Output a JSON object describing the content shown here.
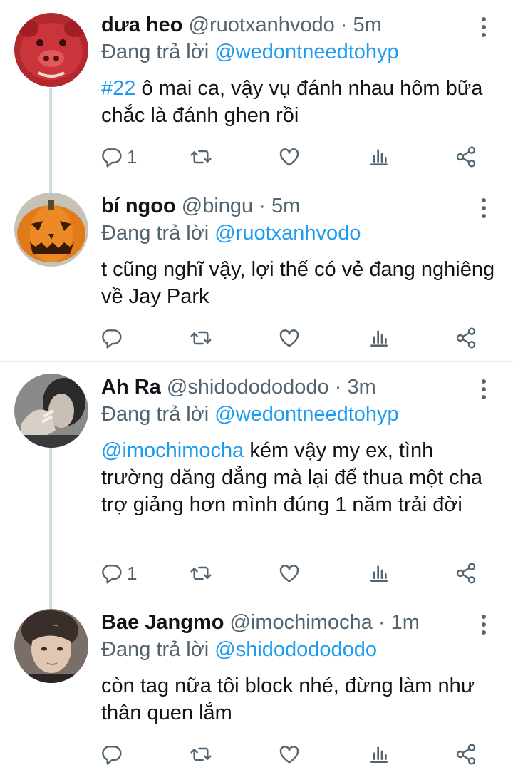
{
  "tweets": [
    {
      "name": "dưa heo",
      "handle": "@ruotxanhvodo",
      "sep": "·",
      "time": "5m",
      "reply_prefix": "Đang trả lời",
      "reply_to": "@wedontneedtohyp",
      "body_link": "#22",
      "body_text": " ô mai ca, vậy vụ đánh nhau hôm bữa chắc là đánh ghen rồi",
      "reply_count": "1"
    },
    {
      "name": "bí ngoo",
      "handle": "@bingu",
      "sep": "·",
      "time": "5m",
      "reply_prefix": "Đang trả lời",
      "reply_to": "@ruotxanhvodo",
      "body_link": "",
      "body_text": "t cũng nghĩ vậy, lợi thế có vẻ đang nghiêng về Jay Park",
      "reply_count": ""
    },
    {
      "name": "Ah Ra",
      "handle": "@shidododododo",
      "sep": "·",
      "time": "3m",
      "reply_prefix": "Đang trả lời",
      "reply_to": "@wedontneedtohyp",
      "body_link": "@imochimocha",
      "body_text": " kém vậy my ex, tình trường dăng dẳng mà lại để thua một cha trợ giảng hơn mình đúng 1 năm trải đời",
      "reply_count": "1"
    },
    {
      "name": "Bae Jangmo",
      "handle": "@imochimocha",
      "sep": "·",
      "time": "1m",
      "reply_prefix": "Đang trả lời",
      "reply_to": "@shidododododo",
      "body_link": "",
      "body_text": "còn tag nữa tôi block nhé, đừng làm như thân quen lắm",
      "reply_count": ""
    }
  ],
  "colors": {
    "accent": "#1d9bf0",
    "secondary_text": "#536471",
    "thread_line": "#cfd9de"
  },
  "icons": [
    "reply-icon",
    "retweet-icon",
    "like-icon",
    "analytics-icon",
    "share-icon",
    "more-icon"
  ]
}
